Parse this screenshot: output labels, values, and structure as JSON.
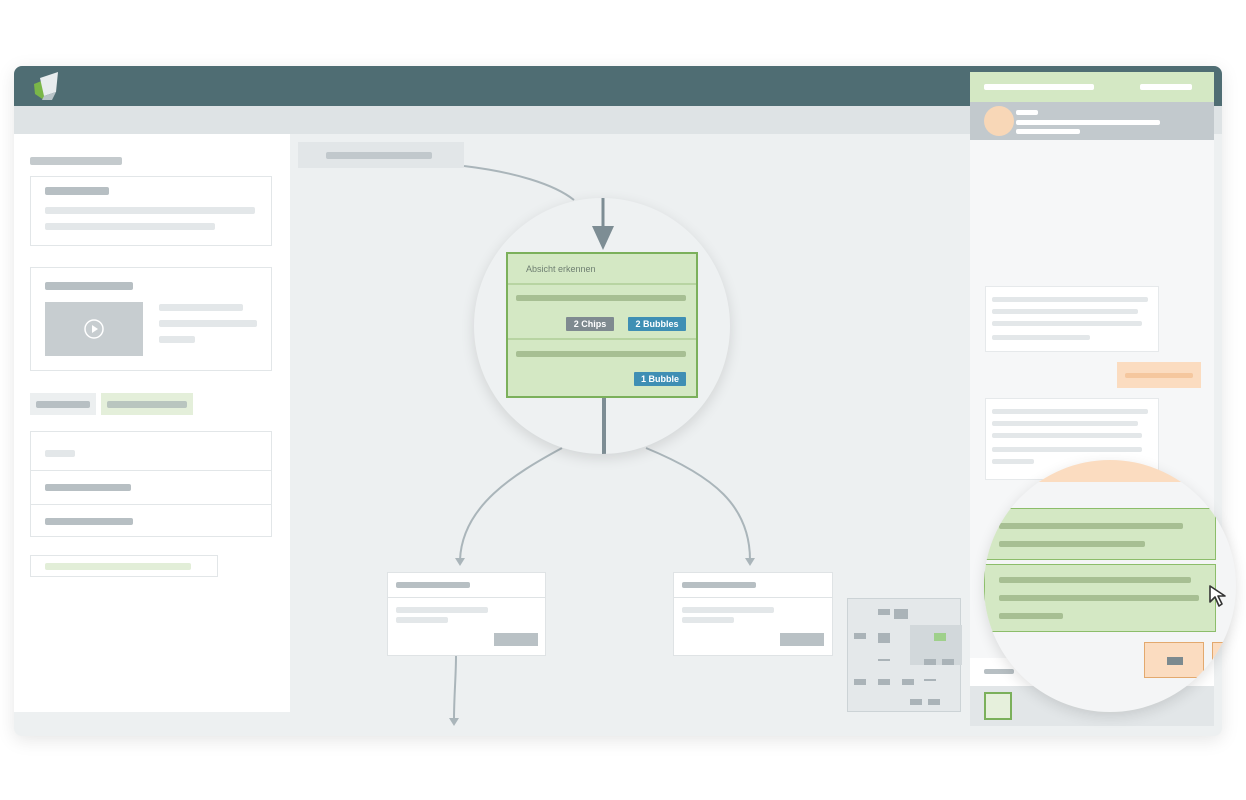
{
  "intent_node": {
    "title": "Absicht erkennen",
    "tag_chips": "2 Chips",
    "tag_bubbles": "2 Bubbles",
    "tag_bubble": "1 Bubble"
  },
  "colors": {
    "topbar": "#4f6d73",
    "accent_green": "#d4e8c4",
    "green_border": "#7bb05b",
    "chip_tag": "#7f8a90",
    "bubble_tag": "#3f8fb4",
    "peach": "#fbdcc0"
  },
  "icons": {
    "logo": "logo-icon",
    "play": "play-icon",
    "cursor": "cursor-icon"
  }
}
